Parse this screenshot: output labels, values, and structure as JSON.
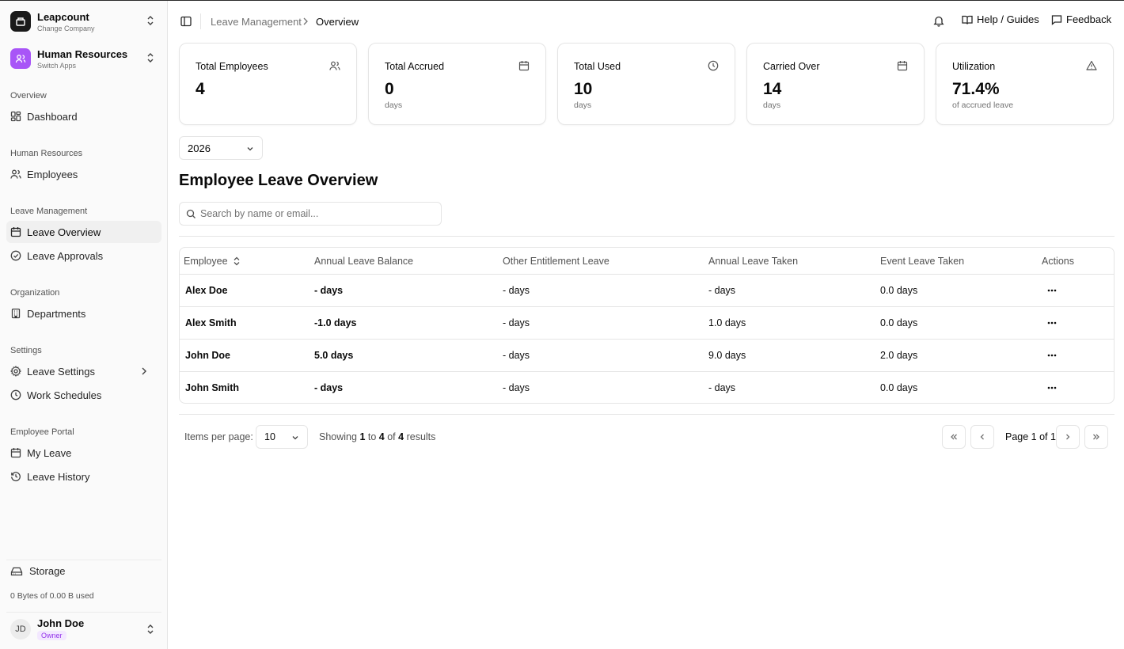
{
  "company": {
    "name": "Leapcount",
    "action": "Change Company"
  },
  "app": {
    "name": "Human Resources",
    "action": "Switch Apps"
  },
  "sidebar": {
    "sections": [
      {
        "title": "Overview",
        "items": [
          {
            "label": "Dashboard",
            "icon": "dashboard-icon"
          }
        ]
      },
      {
        "title": "Human Resources",
        "items": [
          {
            "label": "Employees",
            "icon": "users-icon"
          }
        ]
      },
      {
        "title": "Leave Management",
        "items": [
          {
            "label": "Leave Overview",
            "icon": "calendar-icon",
            "active": true
          },
          {
            "label": "Leave Approvals",
            "icon": "check-circle-icon"
          }
        ]
      },
      {
        "title": "Organization",
        "items": [
          {
            "label": "Departments",
            "icon": "building-icon"
          }
        ]
      },
      {
        "title": "Settings",
        "items": [
          {
            "label": "Leave Settings",
            "icon": "gear-icon"
          },
          {
            "label": "Work Schedules",
            "icon": "clock-icon"
          }
        ]
      },
      {
        "title": "Employee Portal",
        "items": [
          {
            "label": "My Leave",
            "icon": "calendar-icon"
          },
          {
            "label": "Leave History",
            "icon": "history-icon"
          }
        ]
      }
    ],
    "storage": {
      "label": "Storage",
      "used": "0 Bytes of 0.00 B used"
    },
    "user": {
      "initials": "JD",
      "name": "John Doe",
      "role": "Owner"
    }
  },
  "header": {
    "breadcrumb": [
      "Leave Management",
      "Overview"
    ],
    "help": "Help / Guides",
    "feedback": "Feedback"
  },
  "stats": [
    {
      "title": "Total Employees",
      "value": "4",
      "sub": "",
      "icon": "users-icon"
    },
    {
      "title": "Total Accrued",
      "value": "0",
      "sub": "days",
      "icon": "calendar-icon"
    },
    {
      "title": "Total Used",
      "value": "10",
      "sub": "days",
      "icon": "clock-icon"
    },
    {
      "title": "Carried Over",
      "value": "14",
      "sub": "days",
      "icon": "calendar-icon"
    },
    {
      "title": "Utilization",
      "value": "71.4%",
      "sub": "of accrued leave",
      "icon": "warning-icon"
    }
  ],
  "year": "2026",
  "page_title": "Employee Leave Overview",
  "search": {
    "placeholder": "Search by name or email..."
  },
  "table": {
    "columns": [
      "Employee",
      "Annual Leave Balance",
      "Other Entitlement Leave",
      "Annual Leave Taken",
      "Event Leave Taken",
      "Actions"
    ],
    "rows": [
      [
        "Alex Doe",
        "- days",
        "- days",
        "- days",
        "0.0 days"
      ],
      [
        "Alex Smith",
        "-1.0 days",
        "- days",
        "1.0 days",
        "0.0 days"
      ],
      [
        "John Doe",
        "5.0 days",
        "- days",
        "9.0 days",
        "2.0 days"
      ],
      [
        "John Smith",
        "- days",
        "- days",
        "- days",
        "0.0 days"
      ]
    ]
  },
  "pagination": {
    "items_label": "Items per page:",
    "per_page": "10",
    "showing_prefix": "Showing",
    "from": "1",
    "to_word": "to",
    "to": "4",
    "of_word": "of",
    "total": "4",
    "results_word": "results",
    "page_text": "Page 1 of 1"
  },
  "colors": {
    "accent": "#a855f7",
    "dark_logo": "#1a1a1a"
  }
}
